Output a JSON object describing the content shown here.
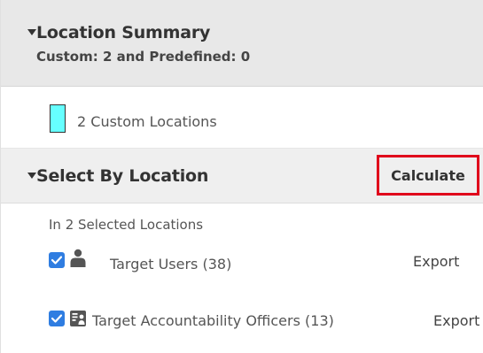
{
  "summary": {
    "title": "Location Summary",
    "subtitle": "Custom: 2 and Predefined: 0"
  },
  "legend": {
    "swatch_color": "#66ffff",
    "label": "2 Custom Locations"
  },
  "select": {
    "title": "Select By Location",
    "calculate_label": "Calculate",
    "highlight_color": "#e0001b"
  },
  "selection": {
    "heading": "In 2 Selected Locations",
    "rows": [
      {
        "icon": "user-icon",
        "label": "Target Users (38)",
        "export_label": "Export",
        "checked": true
      },
      {
        "icon": "officer-badge-icon",
        "label": "Target Accountability Officers (13)",
        "export_label": "Export",
        "checked": true
      }
    ]
  }
}
